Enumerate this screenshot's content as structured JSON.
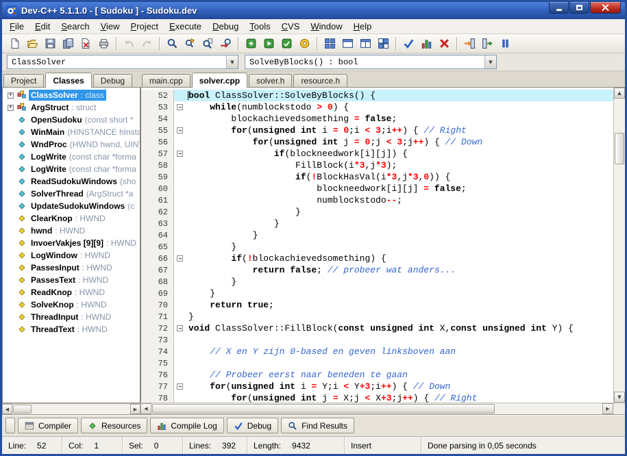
{
  "window": {
    "title": "Dev-C++ 5.1.1.0 - [ Sudoku ] - Sudoku.dev"
  },
  "colors": {
    "titlebar_blue": "#2f5fb8",
    "selection_blue": "#2f96ea",
    "current_line_highlight": "#c8f2fc",
    "comment_blue": "#3366cc",
    "number_operator_red": "#ff0000",
    "close_button_red": "#bb2d1d"
  },
  "menubar": {
    "items": [
      "File",
      "Edit",
      "Search",
      "View",
      "Project",
      "Execute",
      "Debug",
      "Tools",
      "CVS",
      "Window",
      "Help"
    ]
  },
  "toolbar": {
    "buttons": [
      {
        "id": "new-file"
      },
      {
        "id": "open-file"
      },
      {
        "id": "save"
      },
      {
        "id": "save-all"
      },
      {
        "id": "close-file"
      },
      {
        "id": "print"
      },
      {
        "sep": true
      },
      {
        "id": "undo",
        "disabled": true
      },
      {
        "id": "redo",
        "disabled": true
      },
      {
        "sep": true
      },
      {
        "id": "find"
      },
      {
        "id": "replace"
      },
      {
        "id": "find-in-files"
      },
      {
        "id": "goto-line"
      },
      {
        "sep": true
      },
      {
        "id": "compile"
      },
      {
        "id": "run"
      },
      {
        "id": "compile-run"
      },
      {
        "id": "rebuild"
      },
      {
        "sep": true
      },
      {
        "id": "grid"
      },
      {
        "id": "window-pane"
      },
      {
        "id": "split-window"
      },
      {
        "id": "tiles"
      },
      {
        "sep": true
      },
      {
        "id": "syntax-check"
      },
      {
        "id": "profile"
      },
      {
        "id": "abort"
      },
      {
        "sep": true
      },
      {
        "id": "enter-door"
      },
      {
        "id": "exit-door"
      },
      {
        "id": "pause"
      }
    ]
  },
  "combos": {
    "class_selector": "ClassSolver",
    "member_selector": "SolveByBlocks() : bool"
  },
  "left_panel": {
    "tabs": [
      {
        "label": "Project"
      },
      {
        "label": "Classes",
        "active": true
      },
      {
        "label": "Debug"
      }
    ],
    "tree": [
      {
        "name": "ClassSolver",
        "detail": ": class",
        "kind": "class",
        "expandable": true,
        "selected": true
      },
      {
        "name": "ArgStruct",
        "detail": ": struct",
        "kind": "class",
        "expandable": true
      },
      {
        "name": "OpenSudoku",
        "detail": "(const short *",
        "kind": "method"
      },
      {
        "name": "WinMain",
        "detail": "(HINSTANCE hInsta",
        "kind": "method"
      },
      {
        "name": "WndProc",
        "detail": "(HWND hwnd, UINT",
        "kind": "method"
      },
      {
        "name": "LogWrite",
        "detail": "(const char *forma",
        "kind": "method"
      },
      {
        "name": "LogWrite",
        "detail": "(const char *forma",
        "kind": "method"
      },
      {
        "name": "ReadSudokuWindows",
        "detail": "(sho",
        "kind": "method"
      },
      {
        "name": "SolverThread",
        "detail": "(ArgStruct *a",
        "kind": "method"
      },
      {
        "name": "UpdateSudokuWindows",
        "detail": "(c",
        "kind": "method"
      },
      {
        "name": "ClearKnop",
        "detail": ": HWND",
        "kind": "var"
      },
      {
        "name": "hwnd",
        "detail": ": HWND",
        "kind": "var"
      },
      {
        "name": "InvoerVakjes [9][9]",
        "detail": ": HWND",
        "kind": "var"
      },
      {
        "name": "LogWindow",
        "detail": ": HWND",
        "kind": "var"
      },
      {
        "name": "PassesInput",
        "detail": ": HWND",
        "kind": "var"
      },
      {
        "name": "PassesText",
        "detail": ": HWND",
        "kind": "var"
      },
      {
        "name": "ReadKnop",
        "detail": ": HWND",
        "kind": "var"
      },
      {
        "name": "SolveKnop",
        "detail": ": HWND",
        "kind": "var"
      },
      {
        "name": "ThreadInput",
        "detail": ": HWND",
        "kind": "var"
      },
      {
        "name": "ThreadText",
        "detail": ": HWND",
        "kind": "var"
      }
    ]
  },
  "editor": {
    "tabs": [
      {
        "label": "main.cpp"
      },
      {
        "label": "solver.cpp",
        "active": true
      },
      {
        "label": "solver.h"
      },
      {
        "label": "resource.h"
      }
    ],
    "lines": [
      {
        "n": 52,
        "hl": true,
        "seg": [
          [
            "k",
            "bool"
          ],
          [
            "p",
            " ClassSolver::SolveByBlocks() {"
          ]
        ]
      },
      {
        "n": 53,
        "fold": true,
        "seg": [
          [
            "p",
            "    "
          ],
          [
            "k",
            "while"
          ],
          [
            "p",
            "(numblockstodo "
          ],
          [
            "o",
            ">"
          ],
          [
            "p",
            " "
          ],
          [
            "n",
            "0"
          ],
          [
            "p",
            ") {"
          ]
        ]
      },
      {
        "n": 54,
        "seg": [
          [
            "p",
            "        blockachievedsomething "
          ],
          [
            "o",
            "="
          ],
          [
            "p",
            " "
          ],
          [
            "k",
            "false"
          ],
          [
            "p",
            ";"
          ]
        ]
      },
      {
        "n": 55,
        "fold": true,
        "seg": [
          [
            "p",
            "        "
          ],
          [
            "k",
            "for"
          ],
          [
            "p",
            "("
          ],
          [
            "k",
            "unsigned"
          ],
          [
            "p",
            " "
          ],
          [
            "k",
            "int"
          ],
          [
            "p",
            " i "
          ],
          [
            "o",
            "="
          ],
          [
            "p",
            " "
          ],
          [
            "n",
            "0"
          ],
          [
            "p",
            ";i "
          ],
          [
            "o",
            "<"
          ],
          [
            "p",
            " "
          ],
          [
            "n",
            "3"
          ],
          [
            "p",
            ";i"
          ],
          [
            "o",
            "++"
          ],
          [
            "p",
            ") { "
          ],
          [
            "c",
            "// Right"
          ]
        ]
      },
      {
        "n": 56,
        "seg": [
          [
            "p",
            "            "
          ],
          [
            "k",
            "for"
          ],
          [
            "p",
            "("
          ],
          [
            "k",
            "unsigned"
          ],
          [
            "p",
            " "
          ],
          [
            "k",
            "int"
          ],
          [
            "p",
            " j "
          ],
          [
            "o",
            "="
          ],
          [
            "p",
            " "
          ],
          [
            "n",
            "0"
          ],
          [
            "p",
            ";j "
          ],
          [
            "o",
            "<"
          ],
          [
            "p",
            " "
          ],
          [
            "n",
            "3"
          ],
          [
            "p",
            ";j"
          ],
          [
            "o",
            "++"
          ],
          [
            "p",
            ") { "
          ],
          [
            "c",
            "// Down"
          ]
        ]
      },
      {
        "n": 57,
        "fold": true,
        "seg": [
          [
            "p",
            "                "
          ],
          [
            "k",
            "if"
          ],
          [
            "p",
            "(blockneedwork[i][j]) {"
          ]
        ]
      },
      {
        "n": 58,
        "seg": [
          [
            "p",
            "                    FillBlock(i"
          ],
          [
            "o",
            "*"
          ],
          [
            "n",
            "3"
          ],
          [
            "p",
            ",j"
          ],
          [
            "o",
            "*"
          ],
          [
            "n",
            "3"
          ],
          [
            "p",
            ");"
          ]
        ]
      },
      {
        "n": 59,
        "seg": [
          [
            "p",
            "                    "
          ],
          [
            "k",
            "if"
          ],
          [
            "p",
            "("
          ],
          [
            "o",
            "!"
          ],
          [
            "p",
            "BlockHasVal(i"
          ],
          [
            "o",
            "*"
          ],
          [
            "n",
            "3"
          ],
          [
            "p",
            ",j"
          ],
          [
            "o",
            "*"
          ],
          [
            "n",
            "3"
          ],
          [
            "p",
            ","
          ],
          [
            "n",
            "0"
          ],
          [
            "p",
            ")) {"
          ]
        ]
      },
      {
        "n": 60,
        "seg": [
          [
            "p",
            "                        blockneedwork[i][j] "
          ],
          [
            "o",
            "="
          ],
          [
            "p",
            " "
          ],
          [
            "k",
            "false"
          ],
          [
            "p",
            ";"
          ]
        ]
      },
      {
        "n": 61,
        "seg": [
          [
            "p",
            "                        numblockstodo"
          ],
          [
            "o",
            "--"
          ],
          [
            "p",
            ";"
          ]
        ]
      },
      {
        "n": 62,
        "seg": [
          [
            "p",
            "                    }"
          ]
        ]
      },
      {
        "n": 63,
        "seg": [
          [
            "p",
            "                }"
          ]
        ]
      },
      {
        "n": 64,
        "seg": [
          [
            "p",
            "            }"
          ]
        ]
      },
      {
        "n": 65,
        "seg": [
          [
            "p",
            "        }"
          ]
        ]
      },
      {
        "n": 66,
        "fold": true,
        "seg": [
          [
            "p",
            "        "
          ],
          [
            "k",
            "if"
          ],
          [
            "p",
            "("
          ],
          [
            "o",
            "!"
          ],
          [
            "p",
            "blockachievedsomething) {"
          ]
        ]
      },
      {
        "n": 67,
        "seg": [
          [
            "p",
            "            "
          ],
          [
            "k",
            "return"
          ],
          [
            "p",
            " "
          ],
          [
            "k",
            "false"
          ],
          [
            "p",
            "; "
          ],
          [
            "c",
            "// probeer wat anders..."
          ]
        ]
      },
      {
        "n": 68,
        "seg": [
          [
            "p",
            "        }"
          ]
        ]
      },
      {
        "n": 69,
        "seg": [
          [
            "p",
            "    }"
          ]
        ]
      },
      {
        "n": 70,
        "seg": [
          [
            "p",
            "    "
          ],
          [
            "k",
            "return"
          ],
          [
            "p",
            " "
          ],
          [
            "k",
            "true"
          ],
          [
            "p",
            ";"
          ]
        ]
      },
      {
        "n": 71,
        "seg": [
          [
            "p",
            "}"
          ]
        ]
      },
      {
        "n": 72,
        "fold": true,
        "seg": [
          [
            "k",
            "void"
          ],
          [
            "p",
            " ClassSolver::FillBlock("
          ],
          [
            "k",
            "const"
          ],
          [
            "p",
            " "
          ],
          [
            "k",
            "unsigned"
          ],
          [
            "p",
            " "
          ],
          [
            "k",
            "int"
          ],
          [
            "p",
            " X,"
          ],
          [
            "k",
            "const"
          ],
          [
            "p",
            " "
          ],
          [
            "k",
            "unsigned"
          ],
          [
            "p",
            " "
          ],
          [
            "k",
            "int"
          ],
          [
            "p",
            " Y) {"
          ]
        ]
      },
      {
        "n": 73,
        "seg": []
      },
      {
        "n": 74,
        "seg": [
          [
            "p",
            "    "
          ],
          [
            "c",
            "// X en Y zijn 0-based en geven linksboven aan"
          ]
        ]
      },
      {
        "n": 75,
        "seg": []
      },
      {
        "n": 76,
        "seg": [
          [
            "p",
            "    "
          ],
          [
            "c",
            "// Probeer eerst naar beneden te gaan"
          ]
        ]
      },
      {
        "n": 77,
        "fold": true,
        "seg": [
          [
            "p",
            "    "
          ],
          [
            "k",
            "for"
          ],
          [
            "p",
            "("
          ],
          [
            "k",
            "unsigned"
          ],
          [
            "p",
            " "
          ],
          [
            "k",
            "int"
          ],
          [
            "p",
            " i "
          ],
          [
            "o",
            "="
          ],
          [
            "p",
            " Y;i "
          ],
          [
            "o",
            "<"
          ],
          [
            "p",
            " Y"
          ],
          [
            "o",
            "+"
          ],
          [
            "n",
            "3"
          ],
          [
            "p",
            ";i"
          ],
          [
            "o",
            "++"
          ],
          [
            "p",
            ") { "
          ],
          [
            "c",
            "// Down"
          ]
        ]
      },
      {
        "n": 78,
        "seg": [
          [
            "p",
            "        "
          ],
          [
            "k",
            "for"
          ],
          [
            "p",
            "("
          ],
          [
            "k",
            "unsigned"
          ],
          [
            "p",
            " "
          ],
          [
            "k",
            "int"
          ],
          [
            "p",
            " j "
          ],
          [
            "o",
            "="
          ],
          [
            "p",
            " X;j "
          ],
          [
            "o",
            "<"
          ],
          [
            "p",
            " X"
          ],
          [
            "o",
            "+"
          ],
          [
            "n",
            "3"
          ],
          [
            "p",
            ";j"
          ],
          [
            "o",
            "++"
          ],
          [
            "p",
            ") { "
          ],
          [
            "c",
            "// Right"
          ]
        ]
      }
    ]
  },
  "bottom_tabs": [
    {
      "label": "Compiler",
      "icon": "compiler"
    },
    {
      "label": "Resources",
      "icon": "resources"
    },
    {
      "label": "Compile Log",
      "icon": "compile-log"
    },
    {
      "label": "Debug",
      "icon": "debug-check"
    },
    {
      "label": "Find Results",
      "icon": "find-results"
    }
  ],
  "statusbar": {
    "cells": [
      {
        "id": "line",
        "label": "Line:",
        "value": "52"
      },
      {
        "id": "col",
        "label": "Col:",
        "value": "1"
      },
      {
        "id": "sel",
        "label": "Sel:",
        "value": "0"
      },
      {
        "id": "lines",
        "label": "Lines:",
        "value": "392"
      },
      {
        "id": "length",
        "label": "Length:",
        "value": "9432"
      },
      {
        "id": "insert-mode",
        "label": "Insert",
        "value": ""
      },
      {
        "id": "message",
        "label": "Done parsing in 0,05 seconds",
        "value": ""
      }
    ]
  }
}
